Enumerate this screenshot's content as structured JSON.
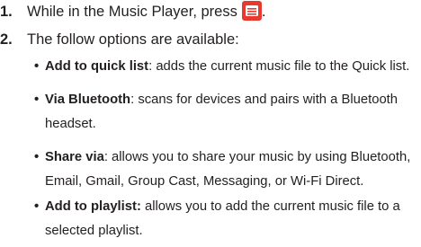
{
  "steps": [
    {
      "number": "1.",
      "text_before_icon": "While in the Music Player, press",
      "icon": "menu-key-icon",
      "text_after_icon": ".",
      "icon_color": "#e8392e"
    },
    {
      "number": "2.",
      "text": "The follow options are available:"
    }
  ],
  "options": [
    {
      "term": "Add to quick list",
      "description": ": adds the current music file to the Quick list."
    },
    {
      "term": "Via Bluetooth",
      "description": ": scans for devices and pairs with a Bluetooth headset."
    },
    {
      "term": "Share via",
      "description": ": allows you to share your music by using Bluetooth, Email, Gmail, Group Cast, Messaging, or Wi-Fi Direct."
    },
    {
      "term": "Add to playlist:",
      "description": " allows you to add the current music file to a selected playlist."
    }
  ],
  "bullet_glyph": "•",
  "text_color": "#231f20"
}
